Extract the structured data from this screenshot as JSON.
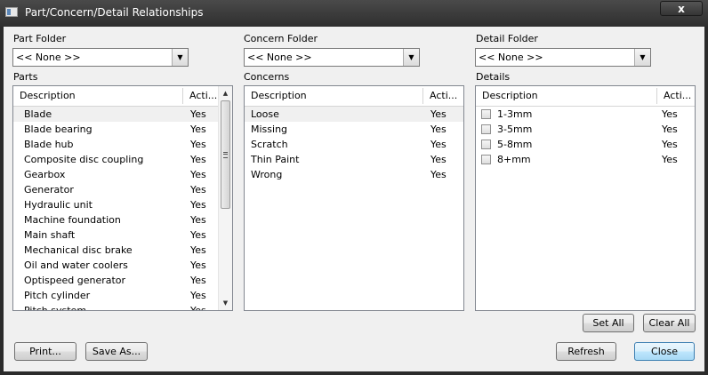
{
  "window": {
    "title": "Part/Concern/Detail Relationships",
    "close_label": "x"
  },
  "part_folder": {
    "label": "Part Folder",
    "value": "<< None >>"
  },
  "concern_folder": {
    "label": "Concern Folder",
    "value": "<< None >>"
  },
  "detail_folder": {
    "label": "Detail Folder",
    "value": "<< None >>"
  },
  "parts": {
    "label": "Parts",
    "columns": [
      "Description",
      "Acti..."
    ],
    "rows": [
      {
        "description": "Blade",
        "active": "Yes"
      },
      {
        "description": "Blade bearing",
        "active": "Yes"
      },
      {
        "description": "Blade hub",
        "active": "Yes"
      },
      {
        "description": "Composite disc coupling",
        "active": "Yes"
      },
      {
        "description": "Gearbox",
        "active": "Yes"
      },
      {
        "description": "Generator",
        "active": "Yes"
      },
      {
        "description": "Hydraulic unit",
        "active": "Yes"
      },
      {
        "description": "Machine foundation",
        "active": "Yes"
      },
      {
        "description": "Main shaft",
        "active": "Yes"
      },
      {
        "description": "Mechanical disc brake",
        "active": "Yes"
      },
      {
        "description": "Oil and water coolers",
        "active": "Yes"
      },
      {
        "description": "Optispeed generator",
        "active": "Yes"
      },
      {
        "description": "Pitch cylinder",
        "active": "Yes"
      },
      {
        "description": "Pitch system",
        "active": "Yes"
      }
    ]
  },
  "concerns": {
    "label": "Concerns",
    "columns": [
      "Description",
      "Acti..."
    ],
    "rows": [
      {
        "description": "Loose",
        "active": "Yes"
      },
      {
        "description": "Missing",
        "active": "Yes"
      },
      {
        "description": "Scratch",
        "active": "Yes"
      },
      {
        "description": "Thin Paint",
        "active": "Yes"
      },
      {
        "description": "Wrong",
        "active": "Yes"
      }
    ]
  },
  "details": {
    "label": "Details",
    "columns": [
      "Description",
      "Acti..."
    ],
    "rows": [
      {
        "description": "1-3mm",
        "active": "Yes",
        "checked": false
      },
      {
        "description": "3-5mm",
        "active": "Yes",
        "checked": false
      },
      {
        "description": "5-8mm",
        "active": "Yes",
        "checked": false
      },
      {
        "description": "8+mm",
        "active": "Yes",
        "checked": false
      }
    ]
  },
  "buttons": {
    "set_all": "Set All",
    "clear_all": "Clear All",
    "print": "Print...",
    "save_as": "Save As...",
    "refresh": "Refresh",
    "close": "Close"
  }
}
